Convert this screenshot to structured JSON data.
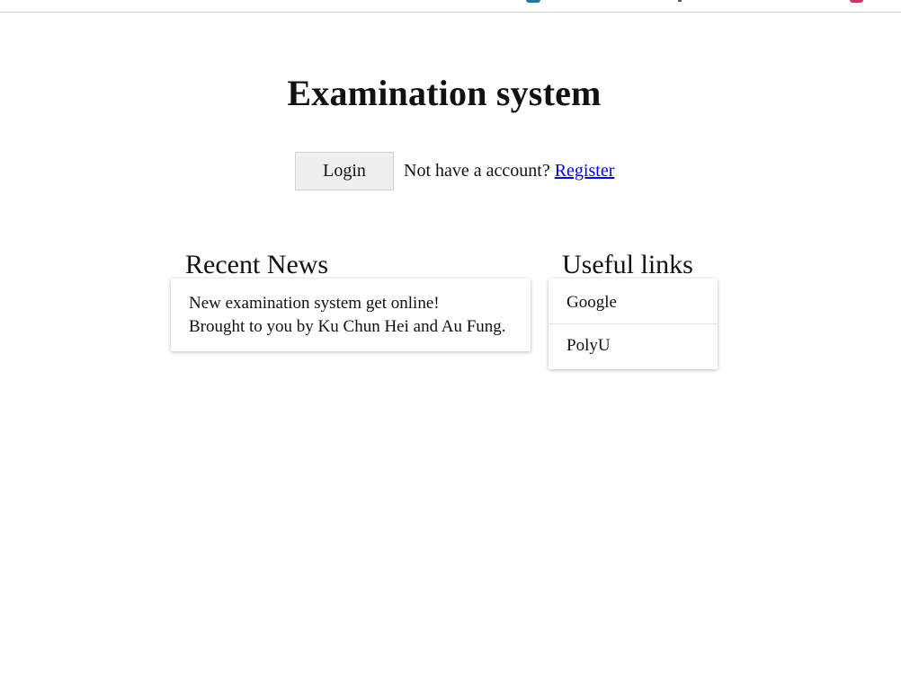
{
  "header": {
    "title": "Examination system"
  },
  "auth": {
    "login_label": "Login",
    "prompt_text": "Not have a account?",
    "register_label": "Register"
  },
  "news": {
    "heading": "Recent News",
    "items": [
      {
        "title": "New examination system get online!",
        "body": "Brought to you by Ku Chun Hei and Au Fung."
      }
    ]
  },
  "links": {
    "heading": "Useful links",
    "items": [
      {
        "label": "Google"
      },
      {
        "label": "PolyU"
      }
    ]
  },
  "colors": {
    "link": "#0000ee",
    "button_bg": "#efefef"
  }
}
